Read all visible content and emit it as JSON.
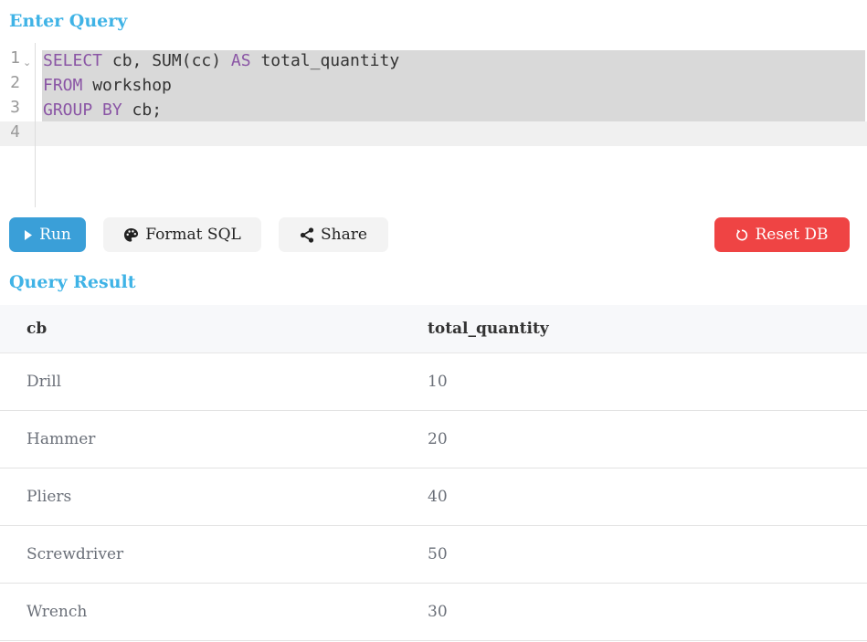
{
  "titles": {
    "enter_query": "Enter Query",
    "query_result": "Query Result"
  },
  "editor": {
    "line_numbers": [
      "1",
      "2",
      "3",
      "4"
    ],
    "lines": [
      [
        {
          "t": "SELECT",
          "kw": true
        },
        {
          "t": " cb, SUM(cc) ",
          "kw": false
        },
        {
          "t": "AS",
          "kw": true
        },
        {
          "t": " total_quantity",
          "kw": false
        }
      ],
      [
        {
          "t": "FROM",
          "kw": true
        },
        {
          "t": " workshop",
          "kw": false
        }
      ],
      [
        {
          "t": "GROUP BY",
          "kw": true
        },
        {
          "t": " cb;",
          "kw": false
        }
      ],
      []
    ],
    "fold_icon": "chevron-down-icon"
  },
  "toolbar": {
    "run_label": "Run",
    "run_icon": "play-icon",
    "format_label": "Format SQL",
    "format_icon": "palette-icon",
    "share_label": "Share",
    "share_icon": "share-icon",
    "reset_label": "Reset DB",
    "reset_icon": "refresh-icon"
  },
  "colors": {
    "accent": "#3fb3e6",
    "run": "#3a9fd8",
    "reset": "#ef4444",
    "keyword": "#8a55a5"
  },
  "result": {
    "columns": [
      "cb",
      "total_quantity"
    ],
    "rows": [
      [
        "Drill",
        "10"
      ],
      [
        "Hammer",
        "20"
      ],
      [
        "Pliers",
        "40"
      ],
      [
        "Screwdriver",
        "50"
      ],
      [
        "Wrench",
        "30"
      ]
    ]
  }
}
